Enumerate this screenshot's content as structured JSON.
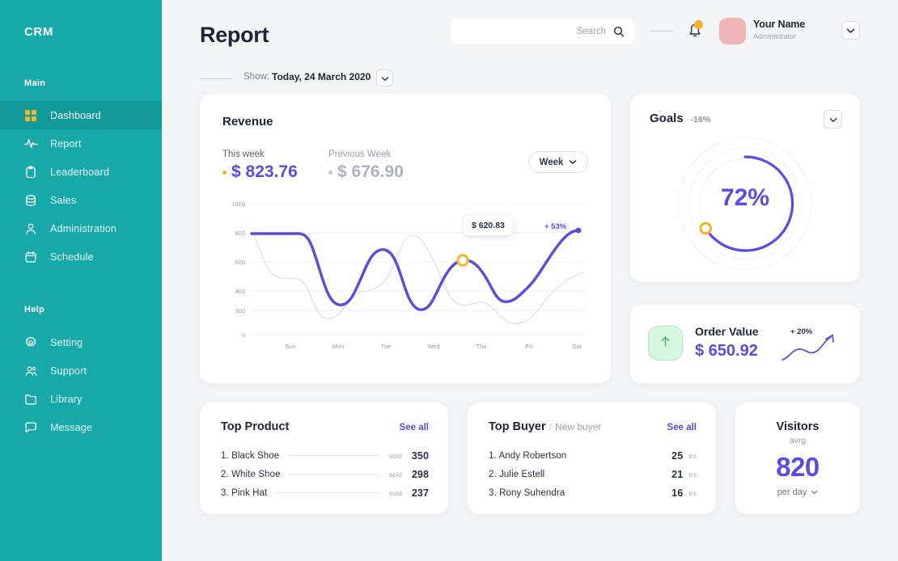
{
  "sidebar": {
    "brand": "CRM",
    "sections": [
      {
        "label": "Main",
        "items": [
          {
            "label": "Dashboard",
            "icon": "grid-icon",
            "active": true
          },
          {
            "label": "Report",
            "icon": "pulse-icon",
            "active": false
          },
          {
            "label": "Leaderboard",
            "icon": "clipboard-icon",
            "active": false
          },
          {
            "label": "Sales",
            "icon": "database-icon",
            "active": false
          },
          {
            "label": "Administration",
            "icon": "user-icon",
            "active": false
          },
          {
            "label": "Schedule",
            "icon": "calendar-icon",
            "active": false
          }
        ]
      },
      {
        "label": "Help",
        "items": [
          {
            "label": "Setting",
            "icon": "gear-icon",
            "active": false
          },
          {
            "label": "Support",
            "icon": "people-icon",
            "active": false
          },
          {
            "label": "Library",
            "icon": "folder-icon",
            "active": false
          },
          {
            "label": "Message",
            "icon": "chat-icon",
            "active": false
          }
        ]
      }
    ]
  },
  "header": {
    "title": "Report",
    "search_placeholder": "Search",
    "search_value": "",
    "search_icon": "search-icon",
    "bell_icon": "bell-icon",
    "user_name": "Your Name",
    "user_role": "Administrator",
    "caret_icon": "chevron-down-icon"
  },
  "filter": {
    "label": "Show:",
    "value": "Today, 24 March 2020",
    "caret_icon": "chevron-down-icon"
  },
  "revenue": {
    "title": "Revenue",
    "this_week_label": "This week",
    "this_week_value": "$ 823.76",
    "prev_week_label": "Previous Week",
    "prev_week_value": "$ 676.90",
    "range_button": "Week",
    "tooltip": "$ 620.83",
    "growth": "+ 53%"
  },
  "goals": {
    "title": "Goals",
    "delta": "-16%",
    "percent": "72%",
    "caret_icon": "chevron-down-icon"
  },
  "order_value": {
    "title": "Order Value",
    "value": "$ 650.92",
    "growth": "+ 20%",
    "badge_icon": "arrow-up-icon"
  },
  "top_product": {
    "title": "Top Product",
    "see_all": "See all",
    "unit": "sold",
    "rows": [
      {
        "name": "1. Black Shoe",
        "value": "350"
      },
      {
        "name": "2. White Shoe",
        "value": "298"
      },
      {
        "name": "3. Pink Hat",
        "value": "237"
      }
    ]
  },
  "top_buyer": {
    "title": "Top Buyer",
    "slash": "/",
    "subtitle": "New buyer",
    "see_all": "See all",
    "unit": "trs",
    "rows": [
      {
        "name": "1. Andy Robertson",
        "value": "25"
      },
      {
        "name": "2. Julie Estell",
        "value": "21"
      },
      {
        "name": "3. Rony Suhendra",
        "value": "16"
      }
    ]
  },
  "visitors": {
    "title": "Visitors",
    "subtitle": "avrg",
    "value": "820",
    "footer": "per day",
    "caret_icon": "chevron-down-icon"
  },
  "colors": {
    "teal": "#17a8a8",
    "teal_active": "#119a9a",
    "purple": "#5b4be0",
    "amber": "#f5b327",
    "pink": "#f0b4b4",
    "green": "#d8f7e0",
    "background": "#f4f5f7"
  },
  "chart_data": {
    "type": "line",
    "title": "Revenue",
    "xlabel": "",
    "ylabel": "",
    "categories": [
      "Sun",
      "Mon",
      "Tue",
      "Wed",
      "Thu",
      "Fri",
      "Sat"
    ],
    "ytick_labels": [
      "1000",
      "800",
      "600",
      "400",
      "300",
      "0"
    ],
    "ylim": [
      0,
      1000
    ],
    "grid": true,
    "legend": "none",
    "series": [
      {
        "name": "This week",
        "color": "#5b4be0",
        "values": [
          800,
          340,
          690,
          310,
          680,
          450,
          760
        ]
      },
      {
        "name": "Previous Week",
        "color": "#dcdee5",
        "values": [
          820,
          285,
          415,
          700,
          360,
          230,
          480
        ]
      }
    ],
    "annotations": [
      {
        "text": "$ 620.83",
        "at": "Thu",
        "marker": "amber-ring"
      },
      {
        "text": "+ 53%",
        "at": "Sat"
      }
    ]
  }
}
